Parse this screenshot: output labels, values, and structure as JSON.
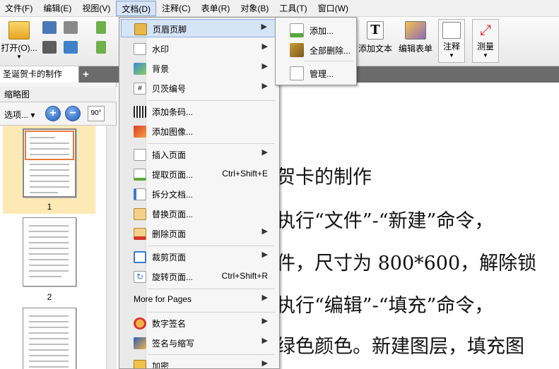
{
  "menubar": {
    "items": [
      "文件(F)",
      "编辑(E)",
      "视图(V)",
      "文档(D)",
      "注释(C)",
      "表单(R)",
      "对象(B)",
      "工具(T)",
      "窗口(W)"
    ]
  },
  "toolbar": {
    "open_label": "打开(O)...",
    "add_text_label": "添加文本",
    "edit_form_label": "编辑表单",
    "annotate_label": "注释",
    "measure_label": "测量"
  },
  "tabs": {
    "active": "圣诞贺卡的制作",
    "add": "+"
  },
  "left_panel": {
    "title": "缩略图",
    "options_label": "选项...",
    "zoom_in": "+",
    "zoom_out": "−",
    "rotate_label": "90°",
    "pages": [
      "1",
      "2"
    ]
  },
  "document": {
    "title_fragment": "贺卡的制作",
    "lines": [
      "执行“文件”-“新建”命令，",
      "件，尺寸为 800*600，解除锁",
      "执行“编辑”-“填充”命令，",
      "绿色颜色。新建图层，填充图"
    ]
  },
  "doc_menu": {
    "items": [
      {
        "label": "页眉页脚",
        "icon": "header-footer-icon",
        "submenu": true,
        "highlight": true
      },
      {
        "label": "水印",
        "icon": "watermark-icon",
        "submenu": true
      },
      {
        "label": "背景",
        "icon": "background-icon",
        "submenu": true
      },
      {
        "label": "贝茨编号",
        "icon": "bates-number-icon",
        "submenu": true
      },
      {
        "label": "添加条码...",
        "icon": "barcode-icon"
      },
      {
        "label": "添加图像...",
        "icon": "add-image-icon"
      },
      {
        "label": "插入页面",
        "icon": "insert-page-icon",
        "submenu": true
      },
      {
        "label": "提取页面...",
        "icon": "extract-page-icon",
        "shortcut": "Ctrl+Shift+E"
      },
      {
        "label": "拆分文档...",
        "icon": "split-document-icon"
      },
      {
        "label": "替换页面...",
        "icon": "replace-page-icon"
      },
      {
        "label": "删除页面",
        "icon": "delete-page-icon",
        "submenu": true
      },
      {
        "label": "裁剪页面",
        "icon": "crop-page-icon",
        "submenu": true
      },
      {
        "label": "旋转页面...",
        "icon": "rotate-page-icon",
        "shortcut": "Ctrl+Shift+R"
      },
      {
        "label": "More for Pages",
        "submenu": true
      },
      {
        "label": "数字签名",
        "icon": "digital-signature-icon",
        "submenu": true
      },
      {
        "label": "签名与缩写",
        "icon": "sign-initials-icon",
        "submenu": true
      },
      {
        "label": "加密",
        "icon": "encrypt-icon",
        "submenu": true
      }
    ],
    "arrow": "▶"
  },
  "header_footer_submenu": {
    "items": [
      "添加...",
      "全部删除...",
      "管理..."
    ]
  },
  "colors": {
    "menu_highlight": "#d5e4f7",
    "thumb_selected": "#fde9b4",
    "thumb_border_active": "#e87b3c"
  }
}
